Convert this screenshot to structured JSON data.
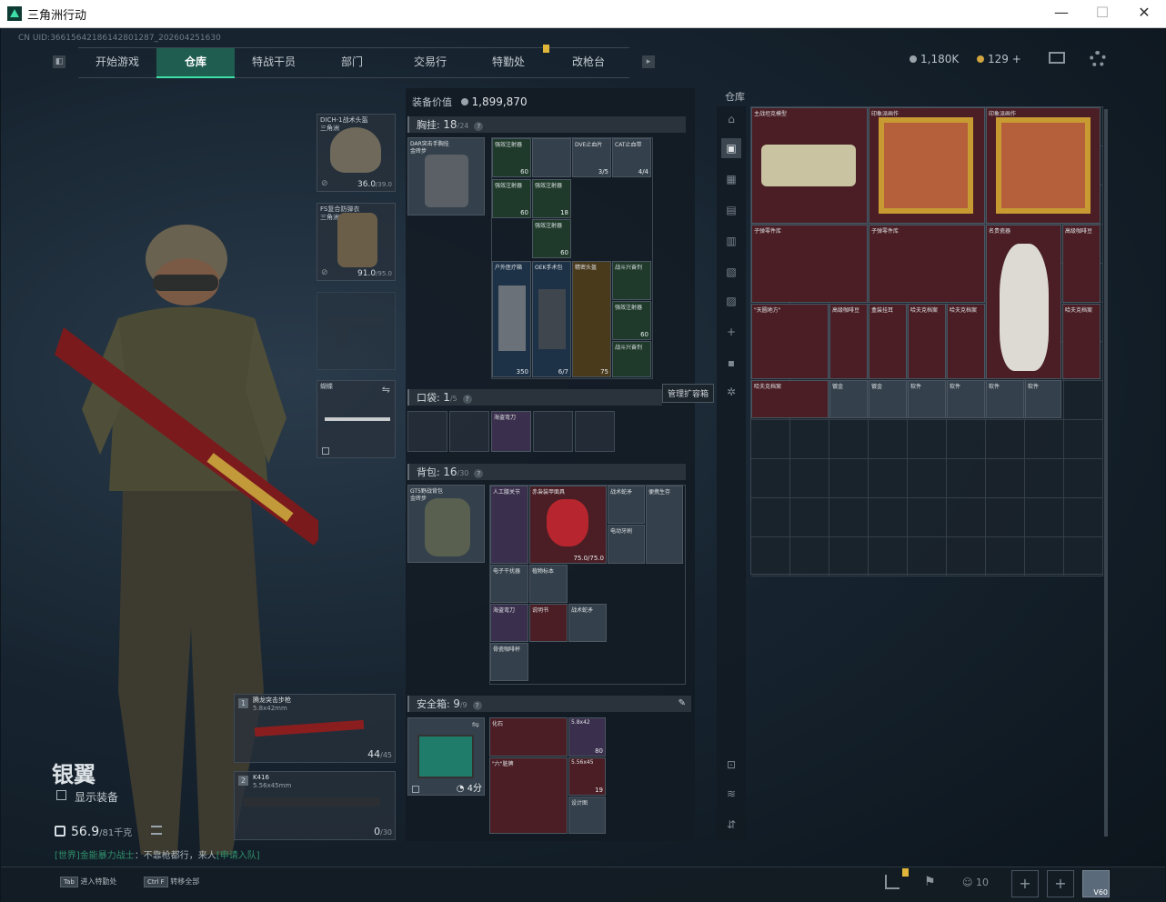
{
  "window": {
    "title": "三角洲行动",
    "min": "—",
    "max": "☐",
    "close": "✕"
  },
  "uid": "CN UID:36615642186142801287_202604251630",
  "nav": {
    "left_btn": "◧",
    "items": [
      "开始游戏",
      "仓库",
      "特战干员",
      "部门",
      "交易行",
      "特勤处",
      "改枪台"
    ],
    "active": "仓库",
    "right_btn": "▸"
  },
  "currency": {
    "silver": "1,180K",
    "gold": "129",
    "plus": "+"
  },
  "icons": {
    "mail": "mail-icon",
    "settings": "gear-icon"
  },
  "character": {
    "name": "银翼",
    "show_equipment": "显示装备",
    "weight": "56.9",
    "weight_max": "/81千克",
    "chat_channel": "[世界]",
    "chat_user": "金能暴力战士",
    "chat_text": "：不靠枪都行，来人",
    "chat_link": "[申请入队]"
  },
  "gear": {
    "helmet": {
      "name": "DICH-1战术头盔",
      "sub": "三角洲",
      "dur": "36.0",
      "dur_max": "/39.0"
    },
    "armor": {
      "name": "FS复合防弹衣",
      "sub": "三角洲",
      "dur": "91.0",
      "dur_max": "/95.0"
    },
    "melee": {
      "name": "蝴蝶"
    }
  },
  "weapons": [
    {
      "idx": "1",
      "name": "腾龙突击步枪",
      "ammo_type": "5.8x42mm",
      "ammo": "44",
      "ammo_max": "/45"
    },
    {
      "idx": "2",
      "name": "K416",
      "ammo_type": "5.56x45mm",
      "ammo": "0",
      "ammo_max": "/30"
    }
  ],
  "equip_value": {
    "label": "装备价值",
    "value": "1,899,870"
  },
  "chest": {
    "label": "胸挂:",
    "count": "18",
    "max": "/24",
    "rig_name": "DAR突击手胸挂",
    "rig_sub": "金砖步",
    "items": [
      "强效注射器",
      "DVE止血片",
      "CAT止血带",
      "强效注射器",
      "强效注射器",
      "强效注射器",
      "户外医疗箱",
      "OEK手术包",
      "精密头盔",
      "战斗兴奋剂",
      "强效注射器",
      "战斗兴奋剂"
    ],
    "counts": [
      "60",
      "3/5",
      "4/4",
      "60",
      "18",
      "60",
      "350",
      "6/7",
      "75",
      "60"
    ]
  },
  "pocket": {
    "label": "口袋:",
    "count": "1",
    "max": "/5",
    "item": "海盗弯刀"
  },
  "tooltip": "管理扩容箱",
  "backpack": {
    "label": "背包:",
    "count": "16",
    "max": "/30",
    "bag_name": "GT5野战背包",
    "bag_sub": "金砖步",
    "items": [
      "人工膝关节",
      "赤枭装甲面具",
      "战术蛇矛",
      "便携生存",
      "电动牙刷",
      "电子干扰器",
      "植物标本",
      "海盗弯刀",
      "说明书",
      "战术蛇矛",
      "骨瓷咖啡杯"
    ],
    "mask_dur": "75.0/75.0"
  },
  "safe": {
    "label": "安全箱:",
    "count": "9",
    "max": "/9",
    "timer": "4分",
    "items": [
      "化石",
      "\"六\"脏牌",
      "5.8x42",
      "5.56x45",
      "设计图"
    ],
    "counts": [
      "80",
      "19"
    ]
  },
  "warehouse": {
    "label": "仓库",
    "items": [
      "主战坦克模型",
      "印象派画作",
      "印象派画作",
      "子弹零件库",
      "子弹零件库",
      "名贵瓷器",
      "高级咖啡豆",
      "\"天圆地方\"",
      "高级咖啡豆",
      "盒装挂耳",
      "哈夫克档案",
      "哈夫克档案",
      "哈夫克档案",
      "哈夫克档案",
      "镀金",
      "镀金",
      "软件",
      "软件",
      "软件",
      "软件"
    ]
  },
  "bottom": {
    "key1": "Tab",
    "label1": "进入特勤处",
    "key2": "Ctrl F",
    "label2": "转移全部",
    "count": "10",
    "level": "V60"
  }
}
